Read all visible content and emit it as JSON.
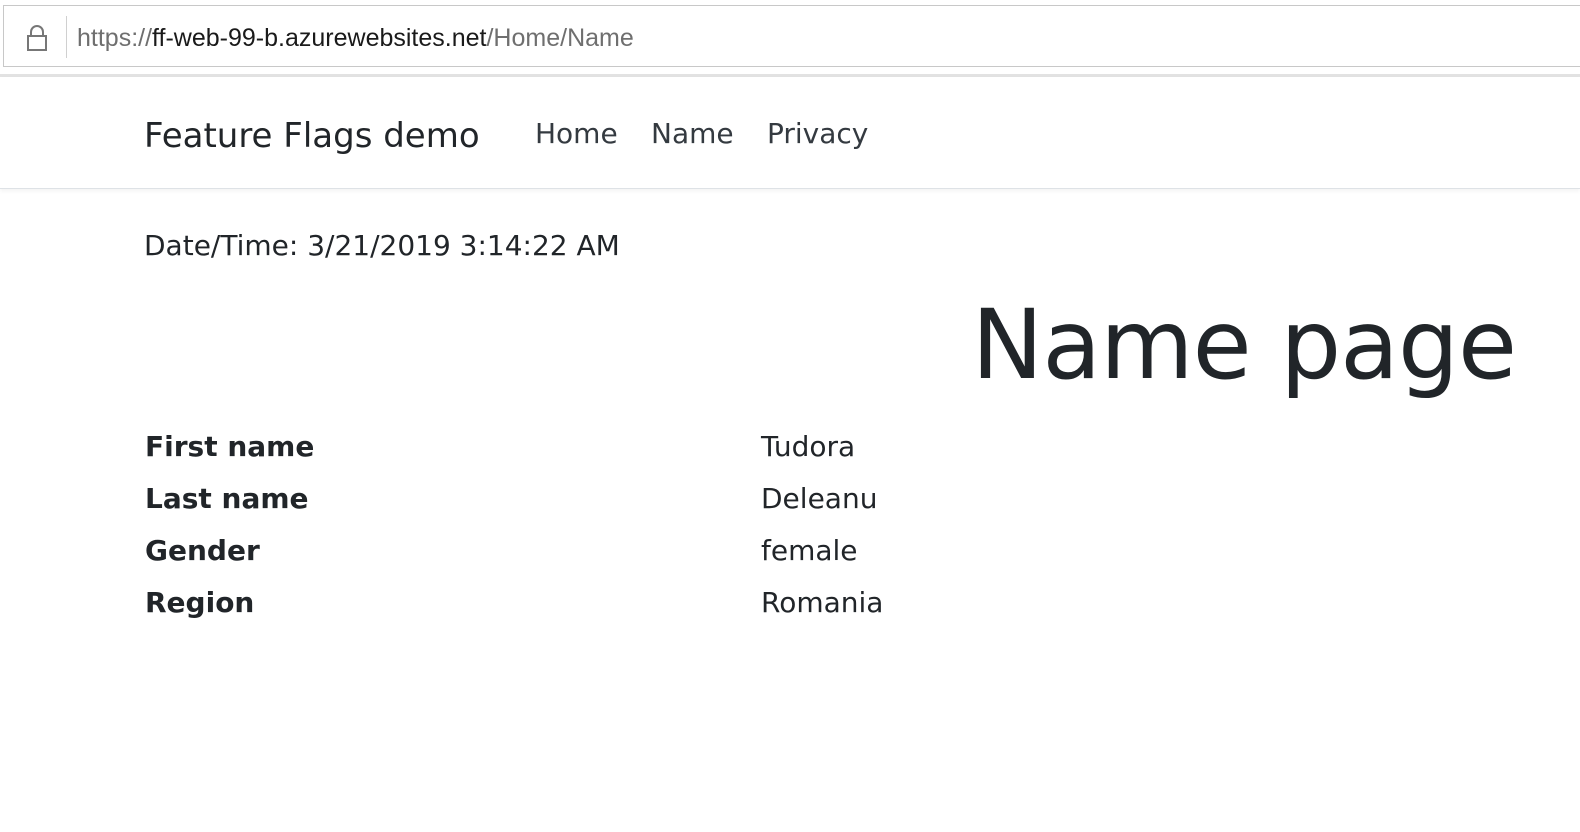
{
  "browser": {
    "url_protocol": "https://",
    "url_host": "ff-web-99-b.azurewebsites.net",
    "url_path": "/Home/Name"
  },
  "navbar": {
    "brand": "Feature Flags demo",
    "links": [
      {
        "label": "Home"
      },
      {
        "label": "Name"
      },
      {
        "label": "Privacy"
      }
    ]
  },
  "main": {
    "datetime": "Date/Time: 3/21/2019 3:14:22 AM",
    "title": "Name page",
    "details": [
      {
        "label": "First name",
        "value": "Tudora"
      },
      {
        "label": "Last name",
        "value": "Deleanu"
      },
      {
        "label": "Gender",
        "value": "female"
      },
      {
        "label": "Region",
        "value": "Romania"
      }
    ]
  }
}
